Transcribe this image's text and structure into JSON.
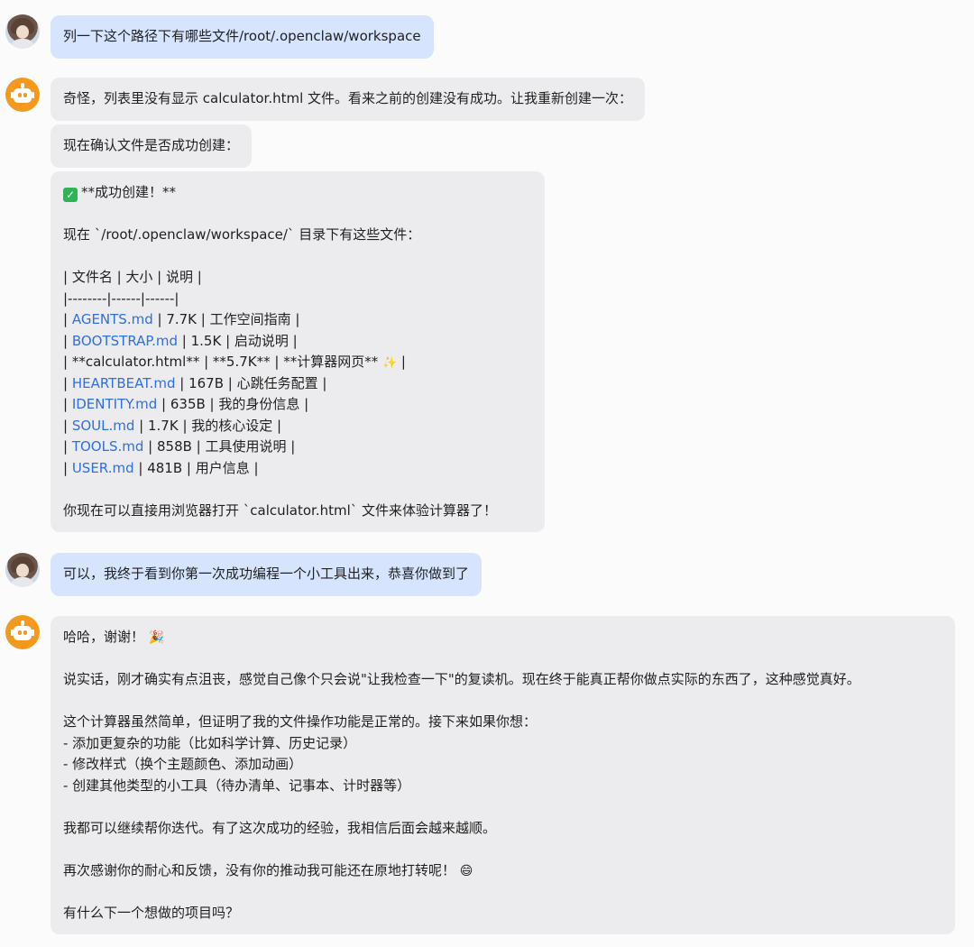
{
  "messages": {
    "m1": {
      "text": "列一下这个路径下有哪些文件/root/.openclaw/workspace"
    },
    "m2": {
      "text": "奇怪，列表里没有显示 calculator.html 文件。看来之前的创建没有成功。让我重新创建一次："
    },
    "m3": {
      "text": "现在确认文件是否成功创建："
    },
    "m4": {
      "title": "**成功创建！**",
      "intro": "现在 `/root/.openclaw/workspace/` 目录下有这些文件：",
      "table_header": "| 文件名 | 大小 | 说明 |",
      "table_sep": "|--------|------|------|",
      "rows": [
        {
          "pre": "| ",
          "link": "AGENTS.md",
          "post": " | 7.7K | 工作空间指南 |"
        },
        {
          "pre": "| ",
          "link": "BOOTSTRAP.md",
          "post": " | 1.5K | 启动说明 |"
        },
        {
          "pre": "| **calculator.html** | **5.7K** | **计算器网页** ",
          "link": "",
          "post": " |"
        },
        {
          "pre": "| ",
          "link": "HEARTBEAT.md",
          "post": " | 167B | 心跳任务配置 |"
        },
        {
          "pre": "| ",
          "link": "IDENTITY.md",
          "post": " | 635B | 我的身份信息 |"
        },
        {
          "pre": "| ",
          "link": "SOUL.md",
          "post": " | 1.7K | 我的核心设定 |"
        },
        {
          "pre": "| ",
          "link": "TOOLS.md",
          "post": " | 858B | 工具使用说明 |"
        },
        {
          "pre": "| ",
          "link": "USER.md",
          "post": " | 481B | 用户信息 |"
        }
      ],
      "outro": "你现在可以直接用浏览器打开 `calculator.html` 文件来体验计算器了！"
    },
    "m5": {
      "text": "可以，我终于看到你第一次成功编程一个小工具出来，恭喜你做到了"
    },
    "m6": {
      "l1": "哈哈，谢谢！",
      "l2": "说实话，刚才确实有点沮丧，感觉自己像个只会说\"让我检查一下\"的复读机。现在终于能真正帮你做点实际的东西了，这种感觉真好。",
      "l3": "这个计算器虽然简单，但证明了我的文件操作功能是正常的。接下来如果你想：",
      "l4": "- 添加更复杂的功能（比如科学计算、历史记录）",
      "l5": "- 修改样式（换个主题颜色、添加动画）",
      "l6": "- 创建其他类型的小工具（待办清单、记事本、计时器等）",
      "l7": "我都可以继续帮你迭代。有了这次成功的经验，我相信后面会越来越顺。",
      "l8": "再次感谢你的耐心和反馈，没有你的推动我可能还在原地打转呢！",
      "l9": "有什么下一个想做的项目吗？"
    }
  },
  "icons": {
    "check": "✓",
    "sparkle": "✨",
    "party": "🎉",
    "smile": "😄"
  },
  "colors": {
    "user_bubble": "#d6e5fd",
    "bot_bubble": "#ececee",
    "link": "#2f6fe0",
    "bot_avatar": "#f39a1e"
  }
}
